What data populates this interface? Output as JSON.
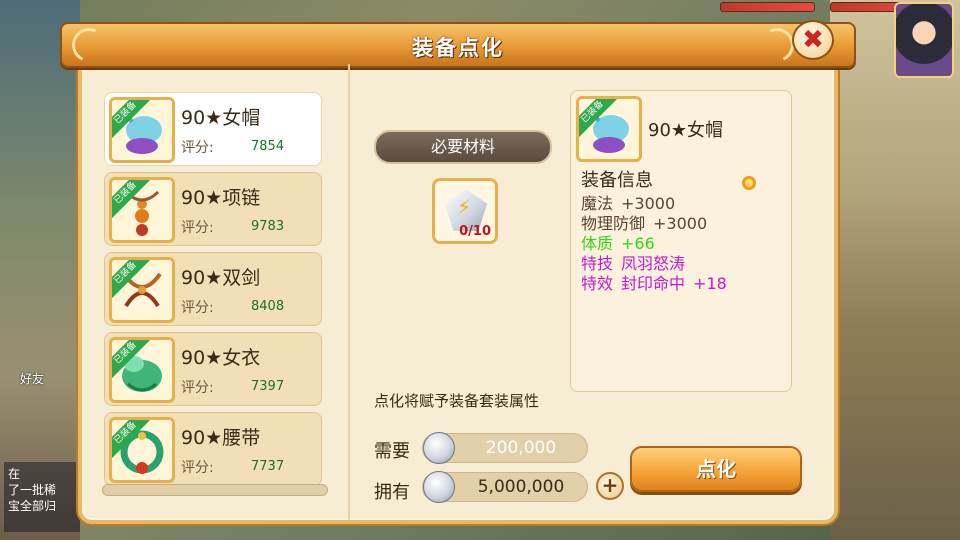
{
  "background": {
    "friend_label": "好友",
    "chat_lines": [
      "在",
      "了一批稀",
      "宝全部归"
    ]
  },
  "dialog": {
    "title": "装备点化",
    "close_symbol": "✖"
  },
  "equipment_list": {
    "equipped_badge": "已装备",
    "score_label": "评分:",
    "items": [
      {
        "name": "90★女帽",
        "score": "7854",
        "icon": "hat-icon",
        "selected": true
      },
      {
        "name": "90★项链",
        "score": "9783",
        "icon": "necklace-icon",
        "selected": false
      },
      {
        "name": "90★双剑",
        "score": "8408",
        "icon": "swords-icon",
        "selected": false
      },
      {
        "name": "90★女衣",
        "score": "7397",
        "icon": "robe-icon",
        "selected": false
      },
      {
        "name": "90★腰带",
        "score": "7737",
        "icon": "belt-icon",
        "selected": false
      }
    ]
  },
  "materials": {
    "banner": "必要材料",
    "slot_count": "0/10",
    "icon": "refine-stone-icon"
  },
  "info": {
    "item_name": "90★女帽",
    "header": "装备信息",
    "stats": [
      {
        "label": "魔法",
        "value": "+3000",
        "color": "#5a4630"
      },
      {
        "label": "物理防御",
        "value": "+3000",
        "color": "#5a4630"
      },
      {
        "label": "体质",
        "value": "+66",
        "color": "#34d617"
      },
      {
        "label": "特技",
        "value": "凤羽怒涛",
        "color": "#c51ad6"
      },
      {
        "label": "特效",
        "value": "封印命中",
        "extra": "+18",
        "color": "#c51ad6"
      }
    ]
  },
  "hint": "点化将赋予装备套装属性",
  "cost": {
    "need_label": "需要",
    "need_value": "200,000",
    "have_label": "拥有",
    "have_value": "5,000,000",
    "plus": "+"
  },
  "refine_button": "点化",
  "colors": {
    "accent": "#e89a35",
    "equipped_badge": "#2ea84a",
    "score": "#1f6f24",
    "special": "#c51ad6",
    "green_stat": "#34d617"
  }
}
